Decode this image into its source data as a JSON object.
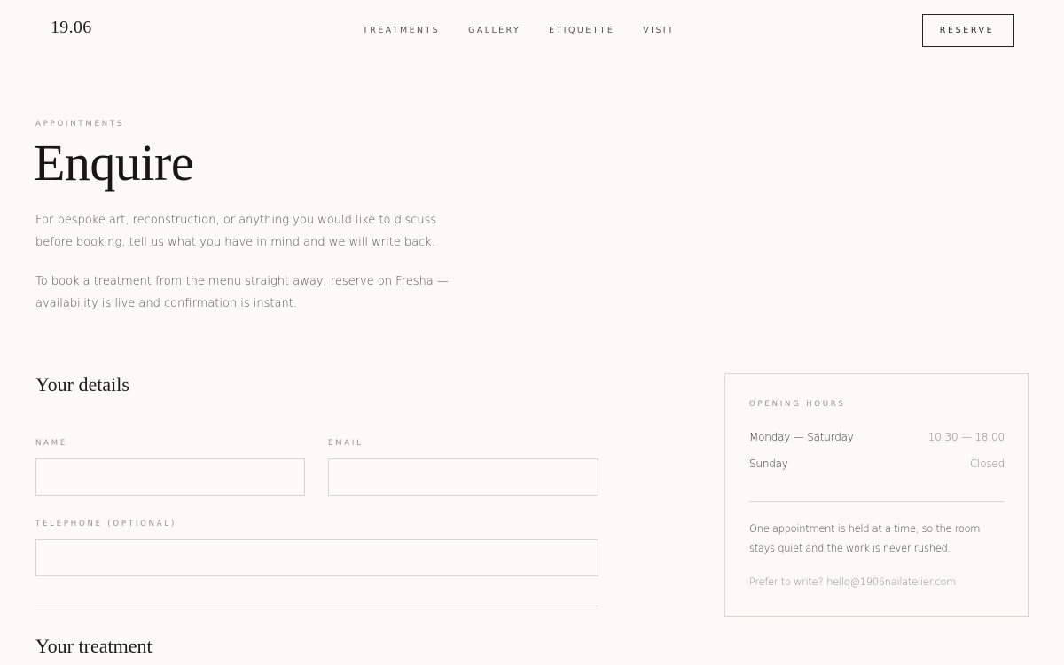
{
  "header": {
    "logo": "19.06",
    "nav": [
      "TREATMENTS",
      "GALLERY",
      "ETIQUETTE",
      "VISIT"
    ],
    "reserve_label": "RESERVE"
  },
  "intro": {
    "eyebrow": "APPOINTMENTS",
    "title": "Enquire",
    "paragraph_1": "For bespoke art, reconstruction, or anything you would like to discuss before booking, tell us what you have in mind and we will write back.",
    "paragraph_2": "To book a treatment from the menu straight away, reserve on Fresha — availability is live and confirmation is instant."
  },
  "form": {
    "details_heading": "Your details",
    "name_label": "NAME",
    "name_value": "",
    "email_label": "EMAIL",
    "email_value": "",
    "telephone_label": "TELEPHONE (OPTIONAL)",
    "telephone_value": "",
    "treatment_heading": "Your treatment"
  },
  "hours": {
    "eyebrow": "OPENING HOURS",
    "rows": [
      {
        "day": "Monday — Saturday",
        "time": "10:30 — 18:00"
      },
      {
        "day": "Sunday",
        "time": "Closed"
      }
    ],
    "note": "One appointment is held at a time, so the room stays quiet and the work is never rushed.",
    "contact_prefix": "Prefer to write?",
    "contact_email": "hello@1906nailatelier.com"
  }
}
